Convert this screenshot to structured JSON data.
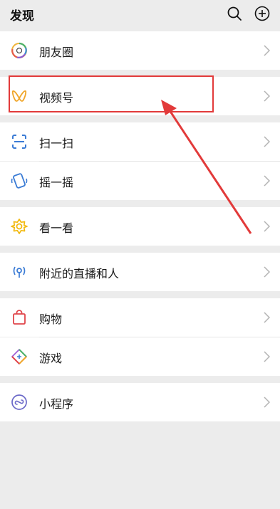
{
  "header": {
    "title": "发现",
    "search_icon": "search-icon",
    "add_icon": "plus-circle-icon"
  },
  "items": [
    {
      "label": "朋友圈",
      "icon": "moments-icon"
    },
    {
      "label": "视频号",
      "icon": "channels-icon"
    },
    {
      "label": "扫一扫",
      "icon": "scan-icon"
    },
    {
      "label": "摇一摇",
      "icon": "shake-icon"
    },
    {
      "label": "看一看",
      "icon": "top-stories-icon"
    },
    {
      "label": "附近的直播和人",
      "icon": "nearby-icon"
    },
    {
      "label": "购物",
      "icon": "shopping-bag-icon"
    },
    {
      "label": "游戏",
      "icon": "games-icon"
    },
    {
      "label": "小程序",
      "icon": "mini-program-icon"
    }
  ],
  "colors": {
    "background": "#ececec",
    "row": "#ffffff",
    "highlight": "#e23a3a",
    "chevron": "#b3b3b3"
  }
}
